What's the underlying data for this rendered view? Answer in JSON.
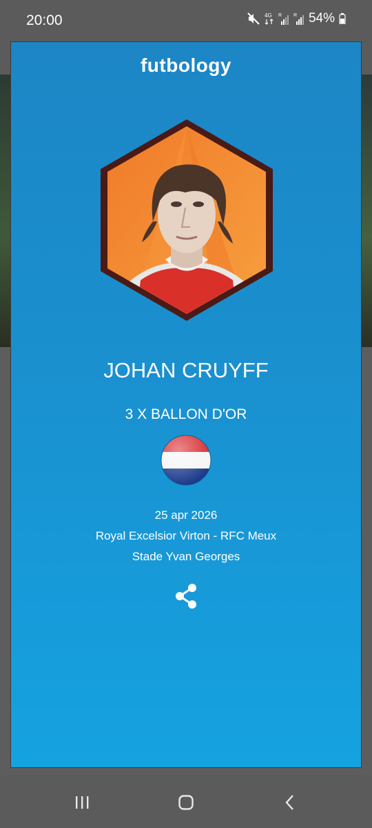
{
  "status_bar": {
    "time": "20:00",
    "battery": "54%",
    "icons": [
      "mute-icon",
      "4g-data-icon",
      "signal-icon",
      "signal-icon",
      "battery-icon"
    ]
  },
  "card": {
    "logo": "futbology",
    "player_name": "JOHAN CRUYFF",
    "award": "3 X BALLON D'OR",
    "flag_icon": "netherlands-flag-icon",
    "date": "25 apr 2026",
    "match": "Royal Excelsior Virton - RFC Meux",
    "stadium": "Stade Yvan Georges",
    "share_icon": "share-icon"
  },
  "nav_bar": {
    "recents_icon": "recents-icon",
    "home_icon": "home-icon",
    "back_icon": "back-icon"
  },
  "colors": {
    "card_top": "#1c86c5",
    "card_bottom": "#15a2e0",
    "hexagon_orange": "#f28a2e",
    "hexagon_border": "#5a1f1a"
  }
}
